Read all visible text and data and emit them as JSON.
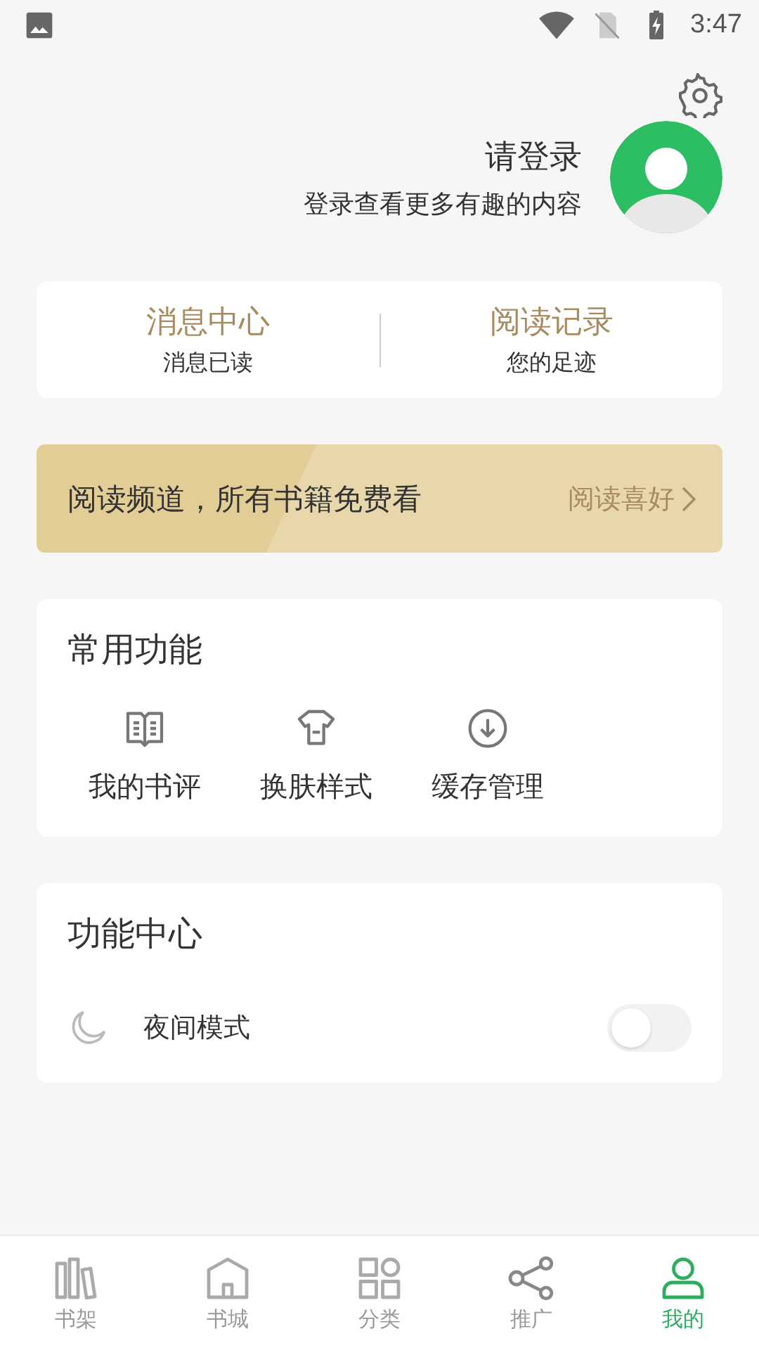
{
  "status_bar": {
    "time": "3:47"
  },
  "profile": {
    "title": "请登录",
    "subtitle": "登录查看更多有趣的内容"
  },
  "stats": [
    {
      "title": "消息中心",
      "subtitle": "消息已读"
    },
    {
      "title": "阅读记录",
      "subtitle": "您的足迹"
    }
  ],
  "banner": {
    "text": "阅读频道，所有书籍免费看",
    "link": "阅读喜好"
  },
  "common_functions": {
    "title": "常用功能",
    "items": [
      {
        "label": "我的书评"
      },
      {
        "label": "换肤样式"
      },
      {
        "label": "缓存管理"
      }
    ]
  },
  "function_center": {
    "title": "功能中心",
    "items": [
      {
        "label": "夜间模式",
        "on": false
      }
    ]
  },
  "tabs": [
    {
      "label": "书架",
      "selected": false
    },
    {
      "label": "书城",
      "selected": false
    },
    {
      "label": "分类",
      "selected": false
    },
    {
      "label": "推广",
      "selected": false
    },
    {
      "label": "我的",
      "selected": true
    }
  ]
}
